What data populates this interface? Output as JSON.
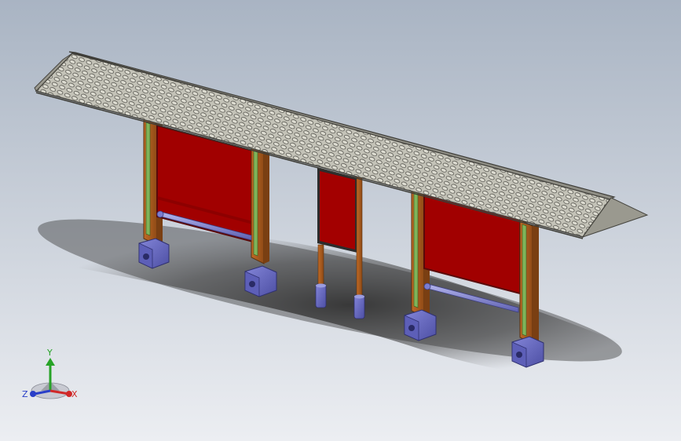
{
  "viewport": {
    "background_top": "#a9b4c3",
    "background_bottom": "#eceef2"
  },
  "colors": {
    "roof": "#b9b8ad",
    "roof_edge": "#4d4c46",
    "panel_red": "#a30000",
    "panel_frame": "#6b1010",
    "post_brown": "#a6581c",
    "post_dark": "#6e3a12",
    "post_green": "#6fa34a",
    "base_blue": "#6d6fc6",
    "base_dark": "#3c3e82",
    "rail_blue": "#8a8cd6",
    "shadow": "#3a3a3a"
  },
  "triad": {
    "y_label": "Y",
    "x_label": "X",
    "z_label": "Z",
    "y_color": "#27a327",
    "x_color": "#d02828",
    "z_color": "#2a3fc8"
  }
}
